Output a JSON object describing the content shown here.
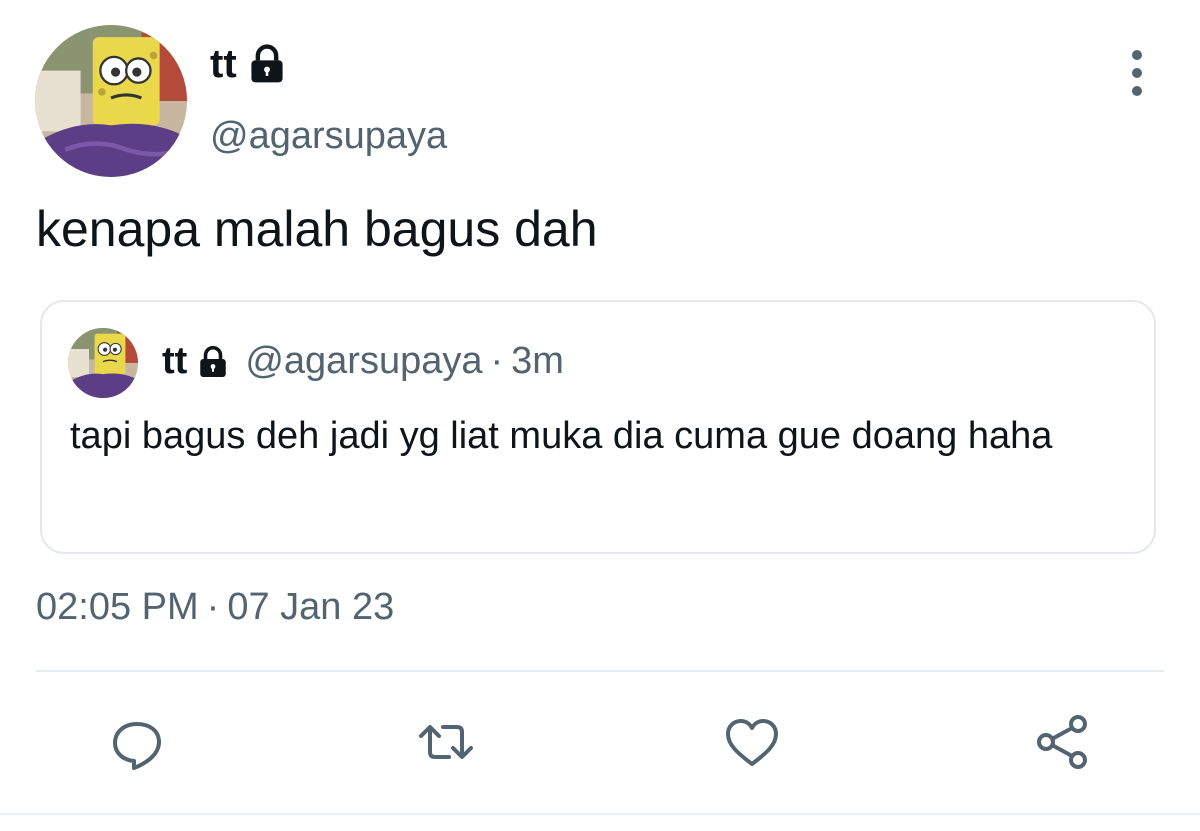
{
  "author": {
    "display_name": "tt",
    "handle": "@agarsupaya",
    "protected_icon": "lock-icon",
    "avatar": "spongebob-avatar"
  },
  "tweet": {
    "text": "kenapa malah bagus dah",
    "time": "02:05 PM",
    "separator": "·",
    "date": "07 Jan 23"
  },
  "quoted_tweet": {
    "display_name": "tt",
    "handle": "@agarsupaya",
    "separator": "·",
    "age": "3m",
    "text": "tapi bagus deh jadi yg liat muka dia cuma gue doang haha"
  },
  "actions": [
    {
      "icon": "reply-icon"
    },
    {
      "icon": "retweet-icon"
    },
    {
      "icon": "heart-icon"
    },
    {
      "icon": "share-icon"
    }
  ],
  "menu_icon": "more-vertical-icon",
  "colors": {
    "primary_text": "#0f1419",
    "secondary_text": "#536471",
    "border": "#e4e8ec",
    "action_icon": "#536471"
  }
}
